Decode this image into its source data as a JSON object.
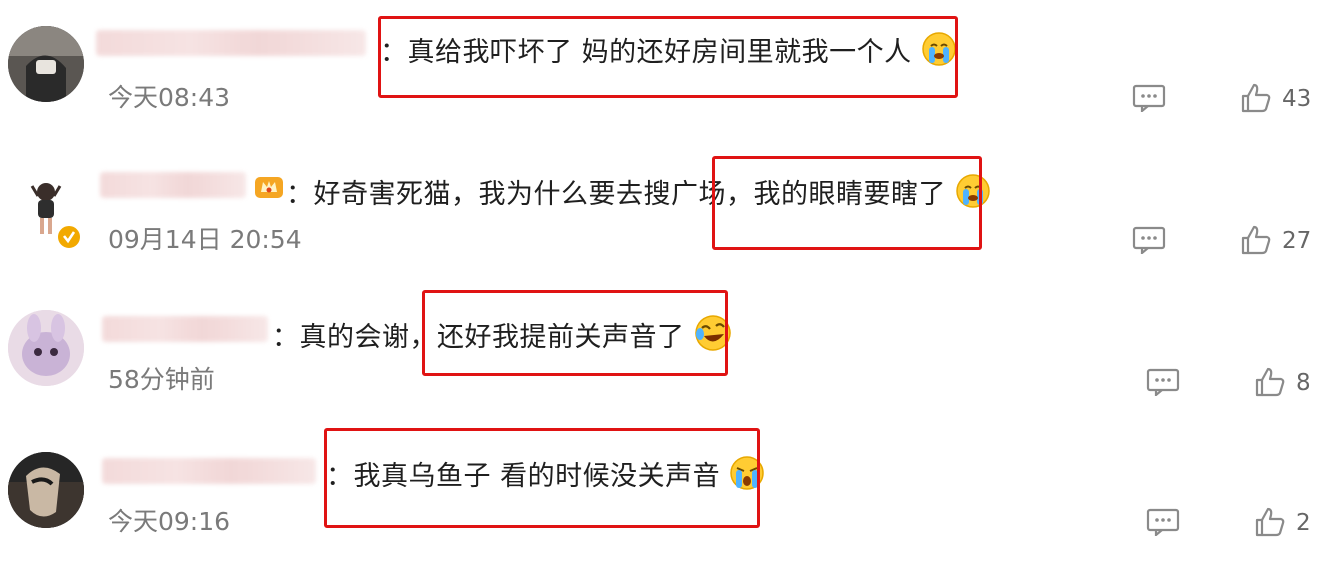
{
  "comments": [
    {
      "separator": "：",
      "text_before": "真给我吓坏了 妈的还好房间里就我一个人",
      "text_highlight": "",
      "emoji": "crying-face",
      "time": "今天08:43",
      "likes": "43"
    },
    {
      "separator": "：",
      "text_before": "好奇害死猫，我为什么要去搜广场，",
      "text_highlight": "我的眼睛要瞎了",
      "emoji": "crying-face",
      "time": "09月14日 20:54",
      "likes": "27"
    },
    {
      "separator": "：",
      "text_before": "真的会谢，",
      "text_highlight": "还好我提前关声音了",
      "emoji": "laughing-crying-face",
      "time": "58分钟前",
      "likes": "8"
    },
    {
      "separator": "：",
      "text_before": "我真乌鱼子 看的时候没关声音",
      "text_highlight": "",
      "emoji": "loudly-crying-face",
      "time": "今天09:16",
      "likes": "2"
    }
  ],
  "colors": {
    "highlight_border": "#e01313",
    "username_blur": "#f3d9d9",
    "time_text": "#7a7a7a",
    "icon_gray": "#8a8a8a"
  }
}
